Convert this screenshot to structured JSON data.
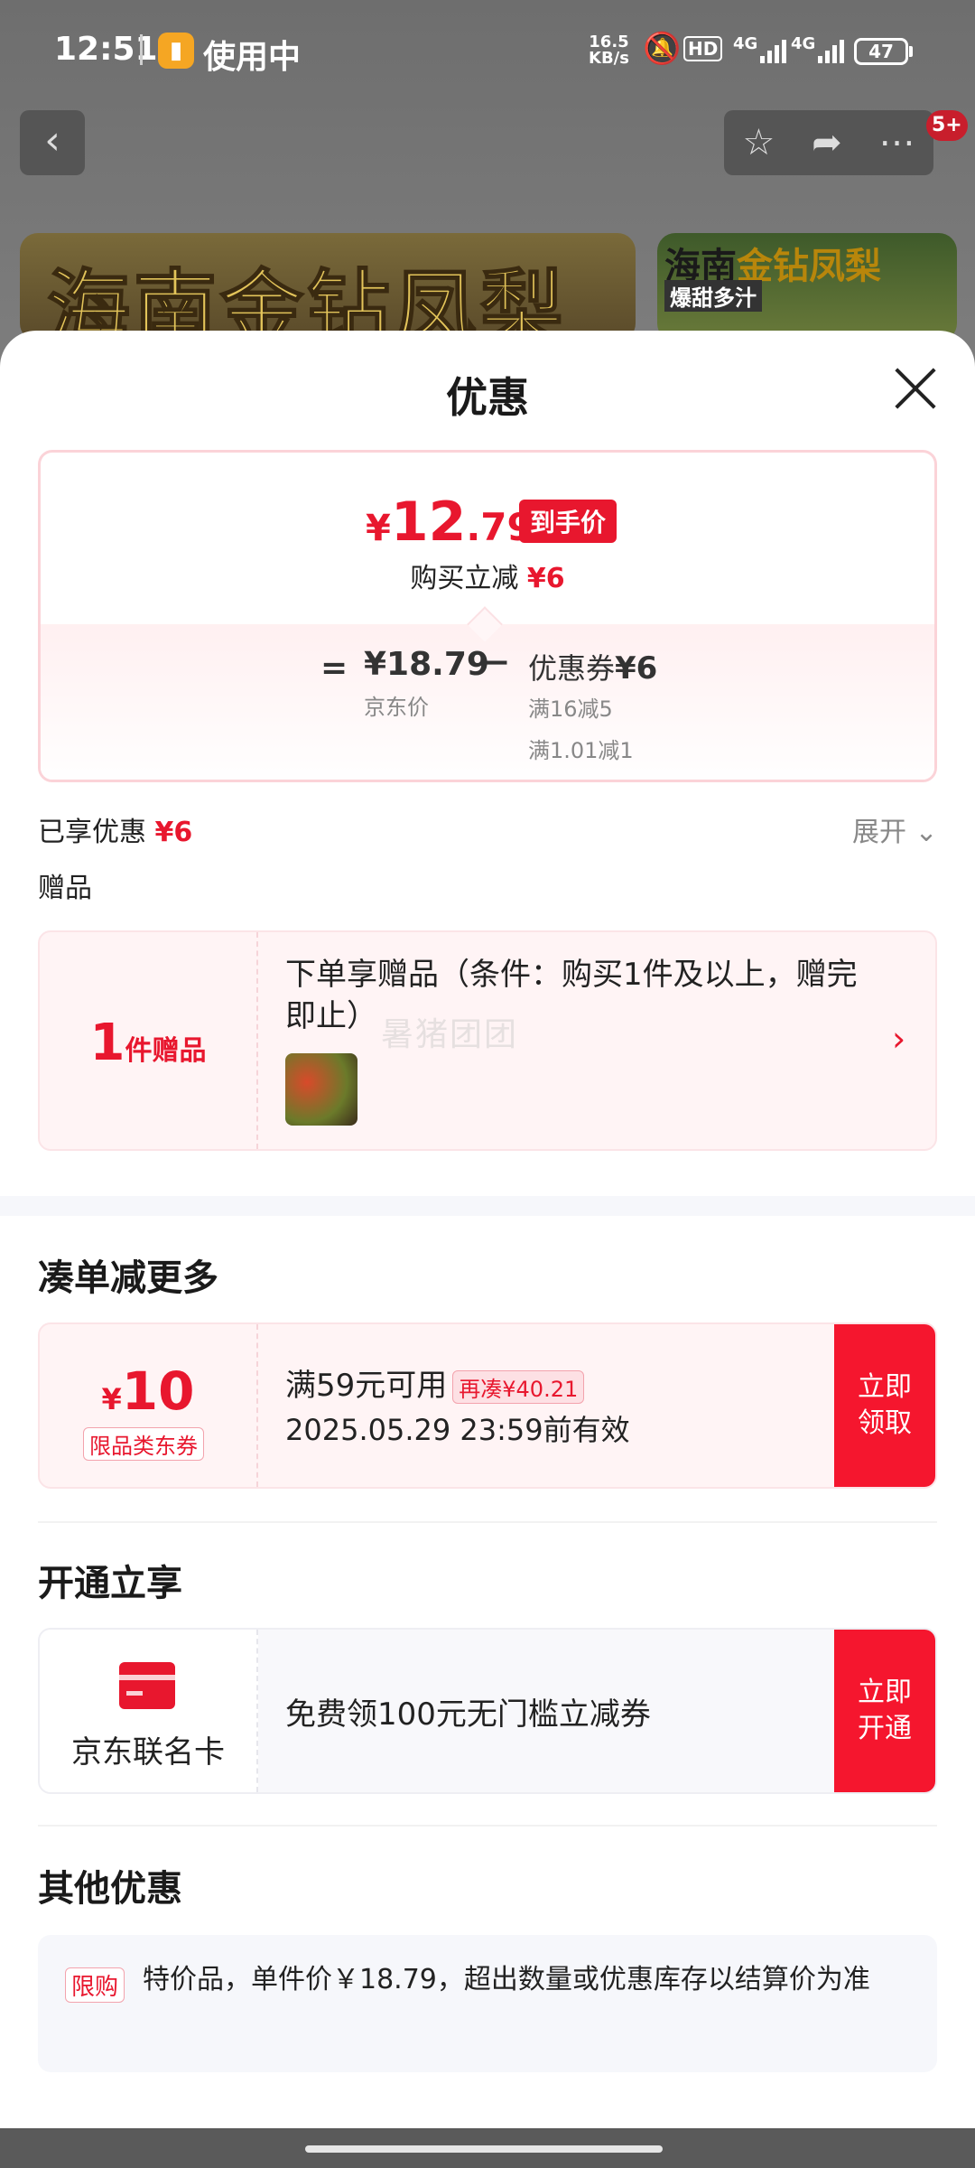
{
  "status_bar": {
    "time": "12:51",
    "app_label": "使用中",
    "net_speed_value": "16.5",
    "net_speed_unit": "KB/s",
    "hd": "HD",
    "signal1": "4G",
    "signal2": "4G",
    "battery": "47",
    "icons": [
      "flashlight-icon",
      "mute-bell-icon",
      "signal-icon",
      "battery-icon"
    ]
  },
  "nav": {
    "back_icon": "chevron-left-icon",
    "action_icons": [
      "star-icon",
      "share-icon",
      "more-icon"
    ],
    "badge": "5+"
  },
  "banners": {
    "left": "海南金钻凤梨",
    "right_a": "海南",
    "right_b": "金钻凤梨",
    "right_sub": "爆甜多汁"
  },
  "sheet": {
    "title": "优惠",
    "price": {
      "currency": "¥",
      "integer": "12",
      "decimal": ".79",
      "tag": "到手价",
      "reduce_label": "购买立减",
      "reduce_value": "¥6",
      "equals": "=",
      "jd_price": "¥18.79",
      "jd_label": "京东价",
      "minus": "−",
      "coupon_label": "优惠券",
      "coupon_value": "¥6",
      "coupon_conditions": [
        "满16减5",
        "满1.01减1"
      ]
    },
    "enjoyed_label": "已享优惠",
    "enjoyed_value": "¥6",
    "expand_label": "展开",
    "gift_section_title": "赠品",
    "gift": {
      "count": "1",
      "count_unit": "件赠品",
      "description": "下单享赠品（条件：购买1件及以上，赠完即止）",
      "watermark": "暑猪团团"
    },
    "bundle": {
      "title": "凑单减更多",
      "amount_currency": "¥",
      "amount": "10",
      "coupon_type": "限品类东券",
      "condition": "满59元可用",
      "tag": "再凑¥40.21",
      "expire": "2025.05.29 23:59前有效",
      "button_line1": "立即",
      "button_line2": "领取"
    },
    "open": {
      "title": "开通立享",
      "card_name": "京东联名卡",
      "description": "免费领100元无门槛立减券",
      "button_line1": "立即",
      "button_line2": "开通"
    },
    "other": {
      "title": "其他优惠",
      "tag": "限购",
      "text": "特价品，单件价￥18.79，超出数量或优惠库存以结算价为准"
    }
  },
  "colors": {
    "accent_red": "#e8172e",
    "button_red": "#f5162e",
    "card_pink": "#fff4f5"
  }
}
